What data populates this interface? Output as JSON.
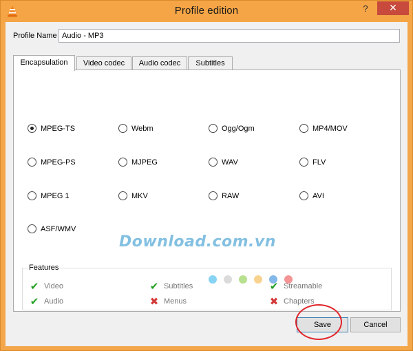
{
  "window": {
    "title": "Profile edition",
    "help_label": "?",
    "close_label": "✕"
  },
  "profile": {
    "label": "Profile Name",
    "value": "Audio - MP3"
  },
  "tabs": [
    {
      "label": "Encapsulation",
      "active": true
    },
    {
      "label": "Video codec",
      "active": false
    },
    {
      "label": "Audio codec",
      "active": false
    },
    {
      "label": "Subtitles",
      "active": false
    }
  ],
  "encapsulation_options": [
    {
      "label": "MPEG-TS",
      "checked": true
    },
    {
      "label": "Webm",
      "checked": false
    },
    {
      "label": "Ogg/Ogm",
      "checked": false
    },
    {
      "label": "MP4/MOV",
      "checked": false
    },
    {
      "label": "MPEG-PS",
      "checked": false
    },
    {
      "label": "MJPEG",
      "checked": false
    },
    {
      "label": "WAV",
      "checked": false
    },
    {
      "label": "FLV",
      "checked": false
    },
    {
      "label": "MPEG 1",
      "checked": false
    },
    {
      "label": "MKV",
      "checked": false
    },
    {
      "label": "RAW",
      "checked": false
    },
    {
      "label": "AVI",
      "checked": false
    },
    {
      "label": "ASF/WMV",
      "checked": false
    }
  ],
  "features": {
    "title": "Features",
    "items": [
      {
        "label": "Video",
        "supported": true
      },
      {
        "label": "Subtitles",
        "supported": true
      },
      {
        "label": "Streamable",
        "supported": true
      },
      {
        "label": "Audio",
        "supported": true
      },
      {
        "label": "Menus",
        "supported": false
      },
      {
        "label": "Chapters",
        "supported": false
      }
    ]
  },
  "watermark": "Download.com.vn",
  "buttons": {
    "save_label": "Save",
    "cancel_label": "Cancel"
  },
  "colors": {
    "titlebar": "#f5a545",
    "close_button": "#c74a3c",
    "annotation_circle": "#e0252b",
    "check": "#22a022",
    "cross": "#d33a3a"
  }
}
